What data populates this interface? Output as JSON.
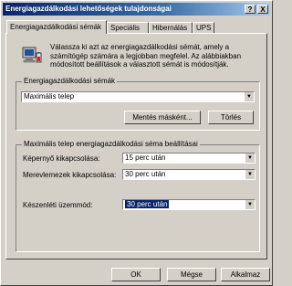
{
  "window": {
    "title": "Energiagazdálkodási lehetőségek tulajdonságai",
    "help_btn": "?",
    "close_btn": "X"
  },
  "tabs": [
    {
      "label": "Energiagazdálkodási sémák"
    },
    {
      "label": "Speciális"
    },
    {
      "label": "Hibernálás"
    },
    {
      "label": "UPS"
    }
  ],
  "intro_text": "Válassza ki azt az energiagazdálkodási sémát, amely a számítógép számára a legjobban megfelel. Az alábbiakban módosított beállítások a választott sémát is módosítják.",
  "scheme_group": {
    "legend": "Energiagazdálkodási sémák",
    "selected_scheme": "Maximális telep",
    "save_as_label": "Mentés másként...",
    "delete_label": "Törlés"
  },
  "settings_group": {
    "legend": "Maximális telep energiagazdálkodási séma beállításai",
    "rows": [
      {
        "label": "Képernyő kikapcsolása:",
        "value": "15 perc után"
      },
      {
        "label": "Merevlemezek kikapcsolása:",
        "value": "30 perc után"
      },
      {
        "label": "Készenléti üzemmód:",
        "value": "30 perc után"
      }
    ]
  },
  "footer": {
    "ok_label": "OK",
    "cancel_label": "Mégse",
    "apply_label": "Alkalmaz"
  },
  "colors": {
    "title_active": "#0a246a",
    "selection": "#0a246a",
    "face": "#d4d0c8"
  }
}
